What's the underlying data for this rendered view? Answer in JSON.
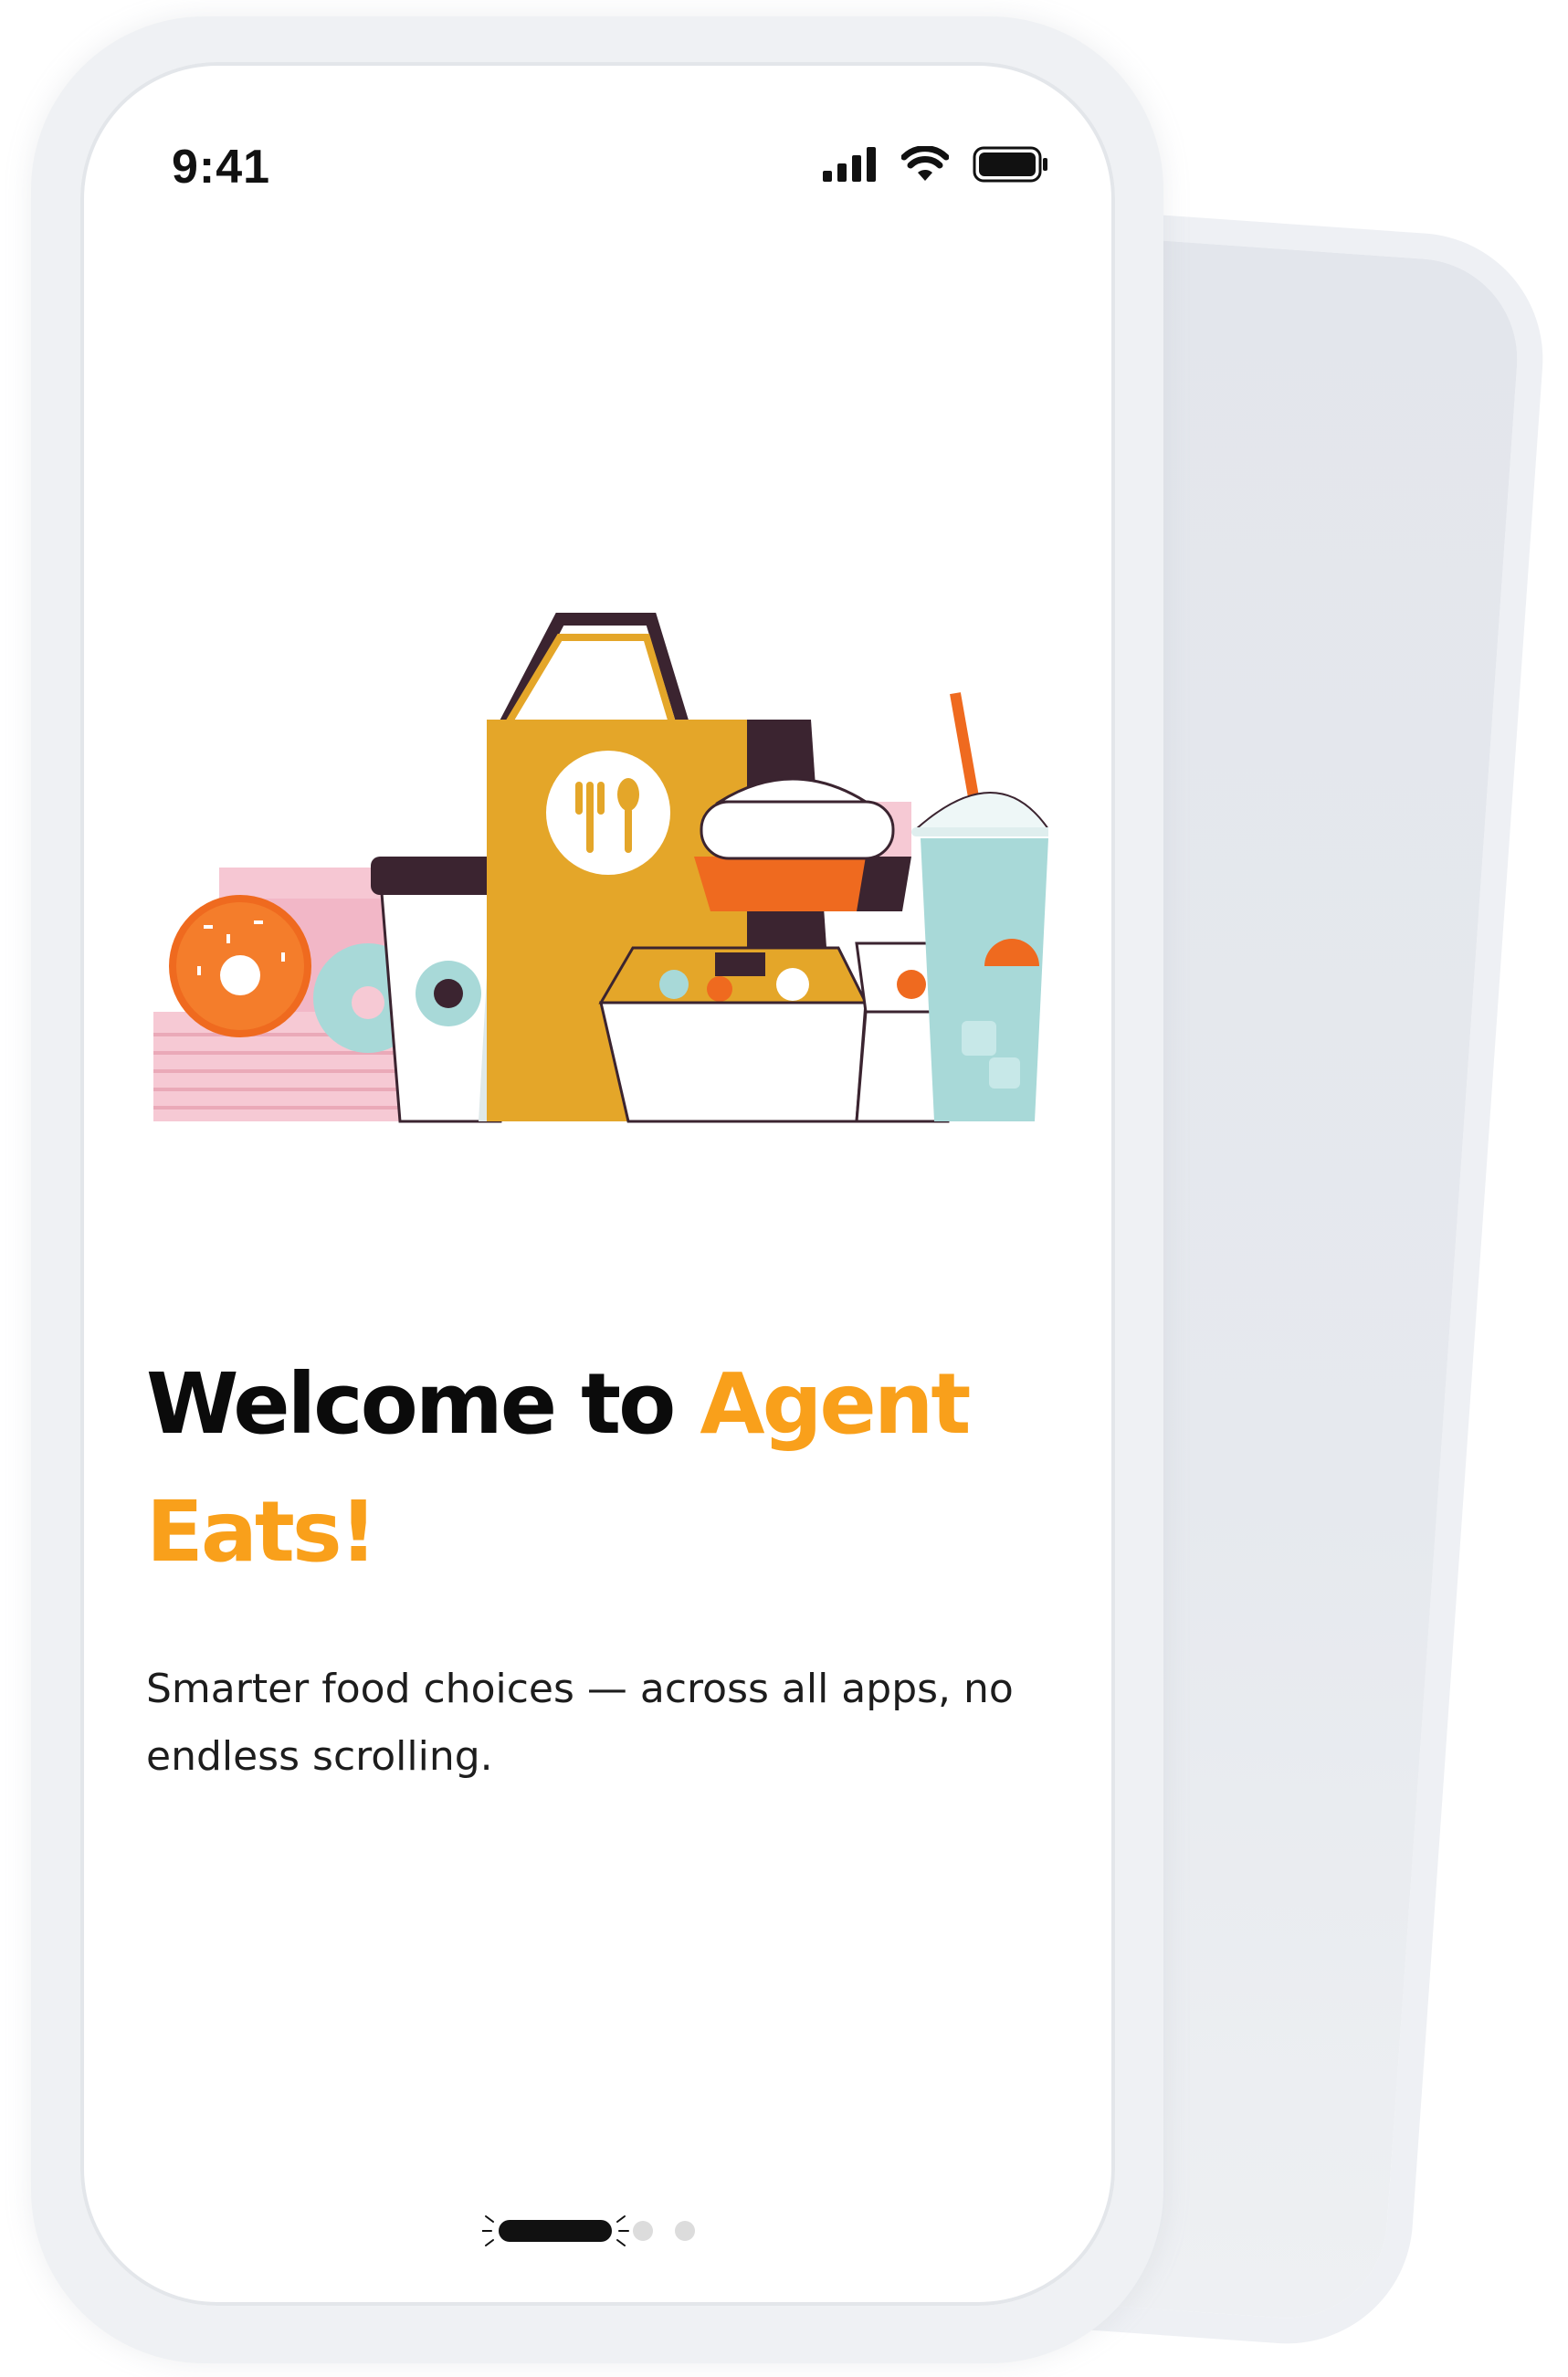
{
  "status_bar": {
    "time": "9:41",
    "icons": [
      "cellular-signal-icon",
      "wifi-icon",
      "battery-icon"
    ]
  },
  "illustration": {
    "icon": "food-delivery-illustration"
  },
  "welcome": {
    "title_part1": "Welcome to ",
    "title_part2": "Agent Eats!",
    "subtitle": "Smarter food choices — across all apps, no endless scrolling."
  },
  "pager": {
    "count": 3,
    "active_index": 0
  },
  "colors": {
    "accent": "#f9a01b",
    "text": "#0b0b0b",
    "bag": "#e4a629",
    "pink": "#f2b7c7",
    "teal": "#a8d9d8",
    "orange": "#ef6a1f",
    "dark": "#3b2430"
  }
}
